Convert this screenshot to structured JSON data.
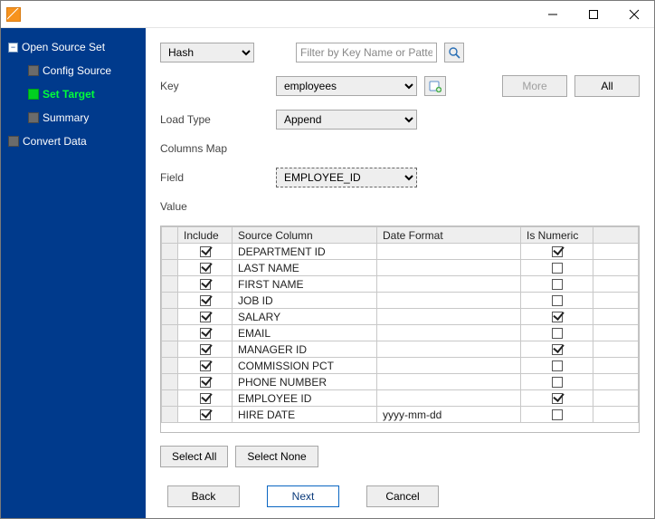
{
  "title": "",
  "sidebar": {
    "parent": "Open Source Set",
    "items": [
      {
        "label": "Config Source",
        "active": false
      },
      {
        "label": "Set Target",
        "active": true
      },
      {
        "label": "Summary",
        "active": false
      }
    ],
    "trailing": "Convert Data"
  },
  "filter": {
    "type_value": "Hash",
    "placeholder": "Filter by Key Name or Pattern"
  },
  "key": {
    "label": "Key",
    "value": "employees",
    "more": "More",
    "all": "All"
  },
  "load_type": {
    "label": "Load Type",
    "value": "Append"
  },
  "columns_map_label": "Columns Map",
  "field": {
    "label": "Field",
    "value": "EMPLOYEE_ID"
  },
  "value_label": "Value",
  "grid": {
    "headers": {
      "include": "Include",
      "source": "Source Column",
      "datefmt": "Date Format",
      "isnum": "Is Numeric"
    },
    "rows": [
      {
        "include": true,
        "source": "DEPARTMENT ID",
        "datefmt": "",
        "isnum": true
      },
      {
        "include": true,
        "source": "LAST NAME",
        "datefmt": "",
        "isnum": false
      },
      {
        "include": true,
        "source": "FIRST NAME",
        "datefmt": "",
        "isnum": false
      },
      {
        "include": true,
        "source": "JOB ID",
        "datefmt": "",
        "isnum": false
      },
      {
        "include": true,
        "source": "SALARY",
        "datefmt": "",
        "isnum": true
      },
      {
        "include": true,
        "source": "EMAIL",
        "datefmt": "",
        "isnum": false
      },
      {
        "include": true,
        "source": "MANAGER ID",
        "datefmt": "",
        "isnum": true
      },
      {
        "include": true,
        "source": "COMMISSION PCT",
        "datefmt": "",
        "isnum": false
      },
      {
        "include": true,
        "source": "PHONE NUMBER",
        "datefmt": "",
        "isnum": false
      },
      {
        "include": true,
        "source": "EMPLOYEE ID",
        "datefmt": "",
        "isnum": true
      },
      {
        "include": true,
        "source": "HIRE DATE",
        "datefmt": "yyyy-mm-dd",
        "isnum": false
      }
    ]
  },
  "buttons": {
    "select_all": "Select All",
    "select_none": "Select None",
    "back": "Back",
    "next": "Next",
    "cancel": "Cancel"
  }
}
